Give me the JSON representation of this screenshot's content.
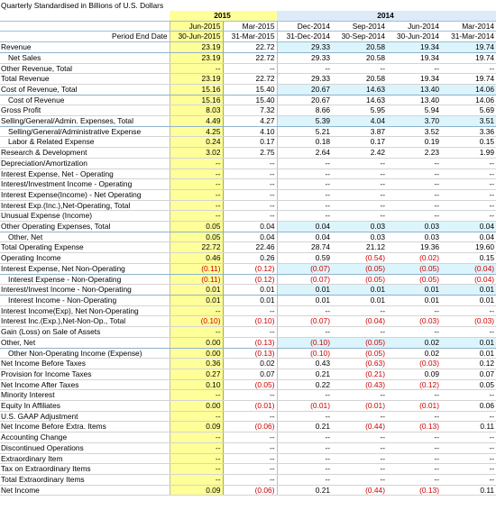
{
  "title": "Quarterly Standardised in Billions of U.S. Dollars",
  "years": [
    "2015",
    "2014"
  ],
  "period_end_label": "Period End Date",
  "columns": [
    {
      "period": "Jun-2015",
      "date": "30-Jun-2015"
    },
    {
      "period": "Mar-2015",
      "date": "31-Mar-2015"
    },
    {
      "period": "Dec-2014",
      "date": "31-Dec-2014"
    },
    {
      "period": "Sep-2014",
      "date": "30-Sep-2014"
    },
    {
      "period": "Jun-2014",
      "date": "30-Jun-2014"
    },
    {
      "period": "Mar-2014",
      "date": "31-Mar-2014"
    }
  ],
  "rows": [
    {
      "label": "Revenue",
      "indent": false,
      "hl": true,
      "values": [
        "23.19",
        "22.72",
        "29.33",
        "20.58",
        "19.34",
        "19.74"
      ]
    },
    {
      "label": "Net Sales",
      "indent": true,
      "hl": false,
      "values": [
        "23.19",
        "22.72",
        "29.33",
        "20.58",
        "19.34",
        "19.74"
      ]
    },
    {
      "label": "Other Revenue, Total",
      "indent": false,
      "hl": false,
      "values": [
        "--",
        "--",
        "--",
        "--",
        "--",
        "--"
      ]
    },
    {
      "label": "Total Revenue",
      "indent": false,
      "hl": false,
      "values": [
        "23.19",
        "22.72",
        "29.33",
        "20.58",
        "19.34",
        "19.74"
      ]
    },
    {
      "label": "Cost of Revenue, Total",
      "indent": false,
      "hl": true,
      "values": [
        "15.16",
        "15.40",
        "20.67",
        "14.63",
        "13.40",
        "14.06"
      ]
    },
    {
      "label": "Cost of Revenue",
      "indent": true,
      "hl": false,
      "values": [
        "15.16",
        "15.40",
        "20.67",
        "14.63",
        "13.40",
        "14.06"
      ]
    },
    {
      "label": "Gross Profit",
      "indent": false,
      "hl": false,
      "values": [
        "8.03",
        "7.32",
        "8.66",
        "5.95",
        "5.94",
        "5.69"
      ]
    },
    {
      "label": "Selling/General/Admin. Expenses, Total",
      "indent": false,
      "hl": true,
      "values": [
        "4.49",
        "4.27",
        "5.39",
        "4.04",
        "3.70",
        "3.51"
      ]
    },
    {
      "label": "Selling/General/Administrative Expense",
      "indent": true,
      "hl": false,
      "values": [
        "4.25",
        "4.10",
        "5.21",
        "3.87",
        "3.52",
        "3.36"
      ]
    },
    {
      "label": "Labor & Related Expense",
      "indent": true,
      "hl": false,
      "values": [
        "0.24",
        "0.17",
        "0.18",
        "0.17",
        "0.19",
        "0.15"
      ]
    },
    {
      "label": "Research & Development",
      "indent": false,
      "hl": false,
      "values": [
        "3.02",
        "2.75",
        "2.64",
        "2.42",
        "2.23",
        "1.99"
      ]
    },
    {
      "label": "Depreciation/Amortization",
      "indent": false,
      "hl": false,
      "values": [
        "--",
        "--",
        "--",
        "--",
        "--",
        "--"
      ]
    },
    {
      "label": "Interest Expense, Net - Operating",
      "indent": false,
      "hl": false,
      "values": [
        "--",
        "--",
        "--",
        "--",
        "--",
        "--"
      ]
    },
    {
      "label": "Interest/Investment Income - Operating",
      "indent": false,
      "hl": false,
      "values": [
        "--",
        "--",
        "--",
        "--",
        "--",
        "--"
      ]
    },
    {
      "label": "Interest Expense(Income) - Net Operating",
      "indent": false,
      "hl": false,
      "values": [
        "--",
        "--",
        "--",
        "--",
        "--",
        "--"
      ]
    },
    {
      "label": "Interest Exp.(Inc.),Net-Operating, Total",
      "indent": false,
      "hl": false,
      "values": [
        "--",
        "--",
        "--",
        "--",
        "--",
        "--"
      ]
    },
    {
      "label": "Unusual Expense (Income)",
      "indent": false,
      "hl": false,
      "values": [
        "--",
        "--",
        "--",
        "--",
        "--",
        "--"
      ]
    },
    {
      "label": "Other Operating Expenses, Total",
      "indent": false,
      "hl": true,
      "values": [
        "0.05",
        "0.04",
        "0.04",
        "0.03",
        "0.03",
        "0.04"
      ]
    },
    {
      "label": "Other, Net",
      "indent": true,
      "hl": false,
      "values": [
        "0.05",
        "0.04",
        "0.04",
        "0.03",
        "0.03",
        "0.04"
      ]
    },
    {
      "label": "Total Operating Expense",
      "indent": false,
      "hl": false,
      "values": [
        "22.72",
        "22.46",
        "28.74",
        "21.12",
        "19.36",
        "19.60"
      ]
    },
    {
      "label": "Operating Income",
      "indent": false,
      "hl": false,
      "values": [
        "0.46",
        "0.26",
        "0.59",
        "(0.54)",
        "(0.02)",
        "0.15"
      ]
    },
    {
      "label": "Interest Expense, Net Non-Operating",
      "indent": false,
      "hl": true,
      "values": [
        "(0.11)",
        "(0.12)",
        "(0.07)",
        "(0.05)",
        "(0.05)",
        "(0.04)"
      ]
    },
    {
      "label": "Interest Expense - Non-Operating",
      "indent": true,
      "hl": false,
      "values": [
        "(0.11)",
        "(0.12)",
        "(0.07)",
        "(0.05)",
        "(0.05)",
        "(0.04)"
      ]
    },
    {
      "label": "Interest/Invest Income - Non-Operating",
      "indent": false,
      "hl": true,
      "values": [
        "0.01",
        "0.01",
        "0.01",
        "0.01",
        "0.01",
        "0.01"
      ]
    },
    {
      "label": "Interest Income - Non-Operating",
      "indent": true,
      "hl": false,
      "values": [
        "0.01",
        "0.01",
        "0.01",
        "0.01",
        "0.01",
        "0.01"
      ]
    },
    {
      "label": "Interest Income(Exp), Net Non-Operating",
      "indent": false,
      "hl": false,
      "values": [
        "--",
        "--",
        "--",
        "--",
        "--",
        "--"
      ]
    },
    {
      "label": "Interest Inc.(Exp.),Net-Non-Op., Total",
      "indent": false,
      "hl": false,
      "values": [
        "(0.10)",
        "(0.10)",
        "(0.07)",
        "(0.04)",
        "(0.03)",
        "(0.03)"
      ]
    },
    {
      "label": "Gain (Loss) on Sale of Assets",
      "indent": false,
      "hl": false,
      "values": [
        "--",
        "--",
        "--",
        "--",
        "--",
        "--"
      ]
    },
    {
      "label": "Other, Net",
      "indent": false,
      "hl": true,
      "values": [
        "0.00",
        "(0.13)",
        "(0.10)",
        "(0.05)",
        "0.02",
        "0.01"
      ]
    },
    {
      "label": "Other Non-Operating Income (Expense)",
      "indent": true,
      "hl": false,
      "values": [
        "0.00",
        "(0.13)",
        "(0.10)",
        "(0.05)",
        "0.02",
        "0.01"
      ]
    },
    {
      "label": "Net Income Before Taxes",
      "indent": false,
      "hl": false,
      "values": [
        "0.36",
        "0.02",
        "0.43",
        "(0.63)",
        "(0.03)",
        "0.12"
      ]
    },
    {
      "label": "Provision for Income Taxes",
      "indent": false,
      "hl": false,
      "values": [
        "0.27",
        "0.07",
        "0.21",
        "(0.21)",
        "0.09",
        "0.07"
      ]
    },
    {
      "label": "Net Income After Taxes",
      "indent": false,
      "hl": false,
      "values": [
        "0.10",
        "(0.05)",
        "0.22",
        "(0.43)",
        "(0.12)",
        "0.05"
      ]
    },
    {
      "label": "Minority Interest",
      "indent": false,
      "hl": false,
      "values": [
        "--",
        "--",
        "--",
        "--",
        "--",
        "--"
      ]
    },
    {
      "label": "Equity In Affiliates",
      "indent": false,
      "hl": false,
      "values": [
        "0.00",
        "(0.01)",
        "(0.01)",
        "(0.01)",
        "(0.01)",
        "0.06"
      ]
    },
    {
      "label": "U.S. GAAP Adjustment",
      "indent": false,
      "hl": false,
      "values": [
        "--",
        "--",
        "--",
        "--",
        "--",
        "--"
      ]
    },
    {
      "label": "Net Income Before Extra. Items",
      "indent": false,
      "hl": false,
      "values": [
        "0.09",
        "(0.06)",
        "0.21",
        "(0.44)",
        "(0.13)",
        "0.11"
      ]
    },
    {
      "label": "Accounting Change",
      "indent": false,
      "hl": false,
      "values": [
        "--",
        "--",
        "--",
        "--",
        "--",
        "--"
      ]
    },
    {
      "label": "Discontinued Operations",
      "indent": false,
      "hl": false,
      "values": [
        "--",
        "--",
        "--",
        "--",
        "--",
        "--"
      ]
    },
    {
      "label": "Extraordinary Item",
      "indent": false,
      "hl": false,
      "values": [
        "--",
        "--",
        "--",
        "--",
        "--",
        "--"
      ]
    },
    {
      "label": "Tax on Extraordinary Items",
      "indent": false,
      "hl": false,
      "values": [
        "--",
        "--",
        "--",
        "--",
        "--",
        "--"
      ]
    },
    {
      "label": "Total Extraordinary Items",
      "indent": false,
      "hl": false,
      "values": [
        "--",
        "--",
        "--",
        "--",
        "--",
        "--"
      ]
    },
    {
      "label": "Net Income",
      "indent": false,
      "hl": false,
      "values": [
        "0.09",
        "(0.06)",
        "0.21",
        "(0.44)",
        "(0.13)",
        "0.11"
      ]
    }
  ]
}
